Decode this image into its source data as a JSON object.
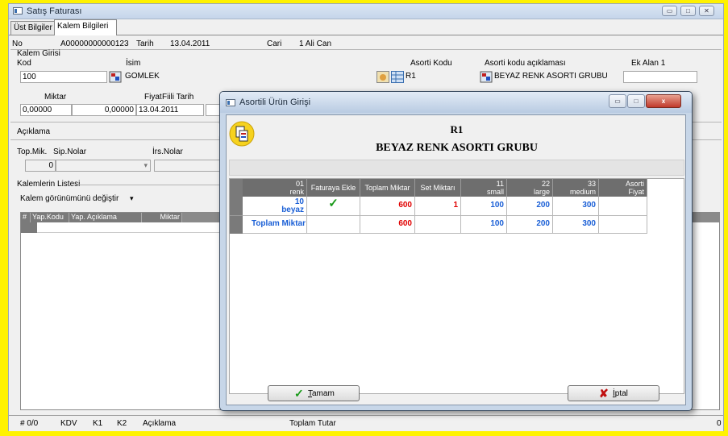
{
  "window": {
    "title": "Satış Faturası",
    "minimize": "▭",
    "maximize": "□",
    "close": "✕"
  },
  "tabs": [
    {
      "label": "Üst Bilgiler"
    },
    {
      "label": "Kalem Bilgileri"
    }
  ],
  "header": {
    "no_label": "No",
    "no_value": "A00000000000123",
    "tarih_label": "Tarih",
    "tarih_value": "13.04.2011",
    "cari_label": "Cari",
    "cari_value": "1 Ali Can"
  },
  "kalem": {
    "group_label": "Kalem Girisi",
    "kod_label": "Kod",
    "kod_value": "100",
    "isim_label": "İsim",
    "isim_value": "GOMLEK",
    "asorti_kodu_label": "Asorti Kodu",
    "asorti_kodu_value": "R1",
    "asorti_aciklama_label": "Asorti kodu açıklaması",
    "asorti_aciklama_value": "BEYAZ RENK ASORTI GRUBU",
    "ek_alan_label": "Ek Alan 1",
    "ek_alan_value": ""
  },
  "miktar": {
    "miktar_label": "Miktar",
    "miktar_value": "0,00000",
    "fiyat_label": "Fiyat",
    "fiyat_value": "0,00000",
    "fiili_tarih_label": "Fiili Tarih",
    "fiili_tarih_value": "13.04.2011"
  },
  "aciklama_label": "Açıklama",
  "top": {
    "topmik_label": "Top.Mik.",
    "topmik_value": "0",
    "sip_label": "Sip.Nolar",
    "irs_label": "İrs.Nolar"
  },
  "list": {
    "group_label": "Kalemlerin Listesi",
    "view_label": "Kalem görünümünü değiştir",
    "columns": [
      "#",
      "Yap.Kodu",
      "Yap. Açıklama",
      "Miktar"
    ]
  },
  "status": {
    "count": "# 0/0",
    "kdv": "KDV",
    "k1": "K1",
    "k2": "K2",
    "aciklama": "Açıklama",
    "toplam_tutar": "Toplam Tutar",
    "total": "0"
  },
  "dialog": {
    "title": "Asortili Ürün Girişi",
    "code": "R1",
    "description": "BEYAZ RENK ASORTI GRUBU",
    "columns": [
      {
        "top": "01",
        "bottom": "renk"
      },
      {
        "top": "",
        "bottom": "Faturaya Ekle"
      },
      {
        "top": "",
        "bottom": "Toplam Miktar"
      },
      {
        "top": "",
        "bottom": "Set Miktarı"
      },
      {
        "top": "11",
        "bottom": "small"
      },
      {
        "top": "22",
        "bottom": "large"
      },
      {
        "top": "33",
        "bottom": "medium"
      },
      {
        "top": "Asorti",
        "bottom": "Fiyat"
      }
    ],
    "rows": [
      {
        "renk_top": "10",
        "renk_bottom": "beyaz",
        "check": "✓",
        "toplam": "600",
        "set": "1",
        "small": "100",
        "large": "200",
        "medium": "300",
        "fiyat": ""
      },
      {
        "label": "Toplam Miktar",
        "toplam": "600",
        "small": "100",
        "large": "200",
        "medium": "300"
      }
    ],
    "ok_label": "Tamam",
    "ok_underline": "T",
    "ok_rest": "amam",
    "cancel_label": "İptal",
    "cancel_underline": "İ",
    "cancel_rest": "ptal"
  },
  "colors": {
    "accent_blue": "#1a5fd6",
    "accent_red": "#e00000",
    "check_green": "#1a9a1a",
    "yellow_border": "#fff200"
  }
}
